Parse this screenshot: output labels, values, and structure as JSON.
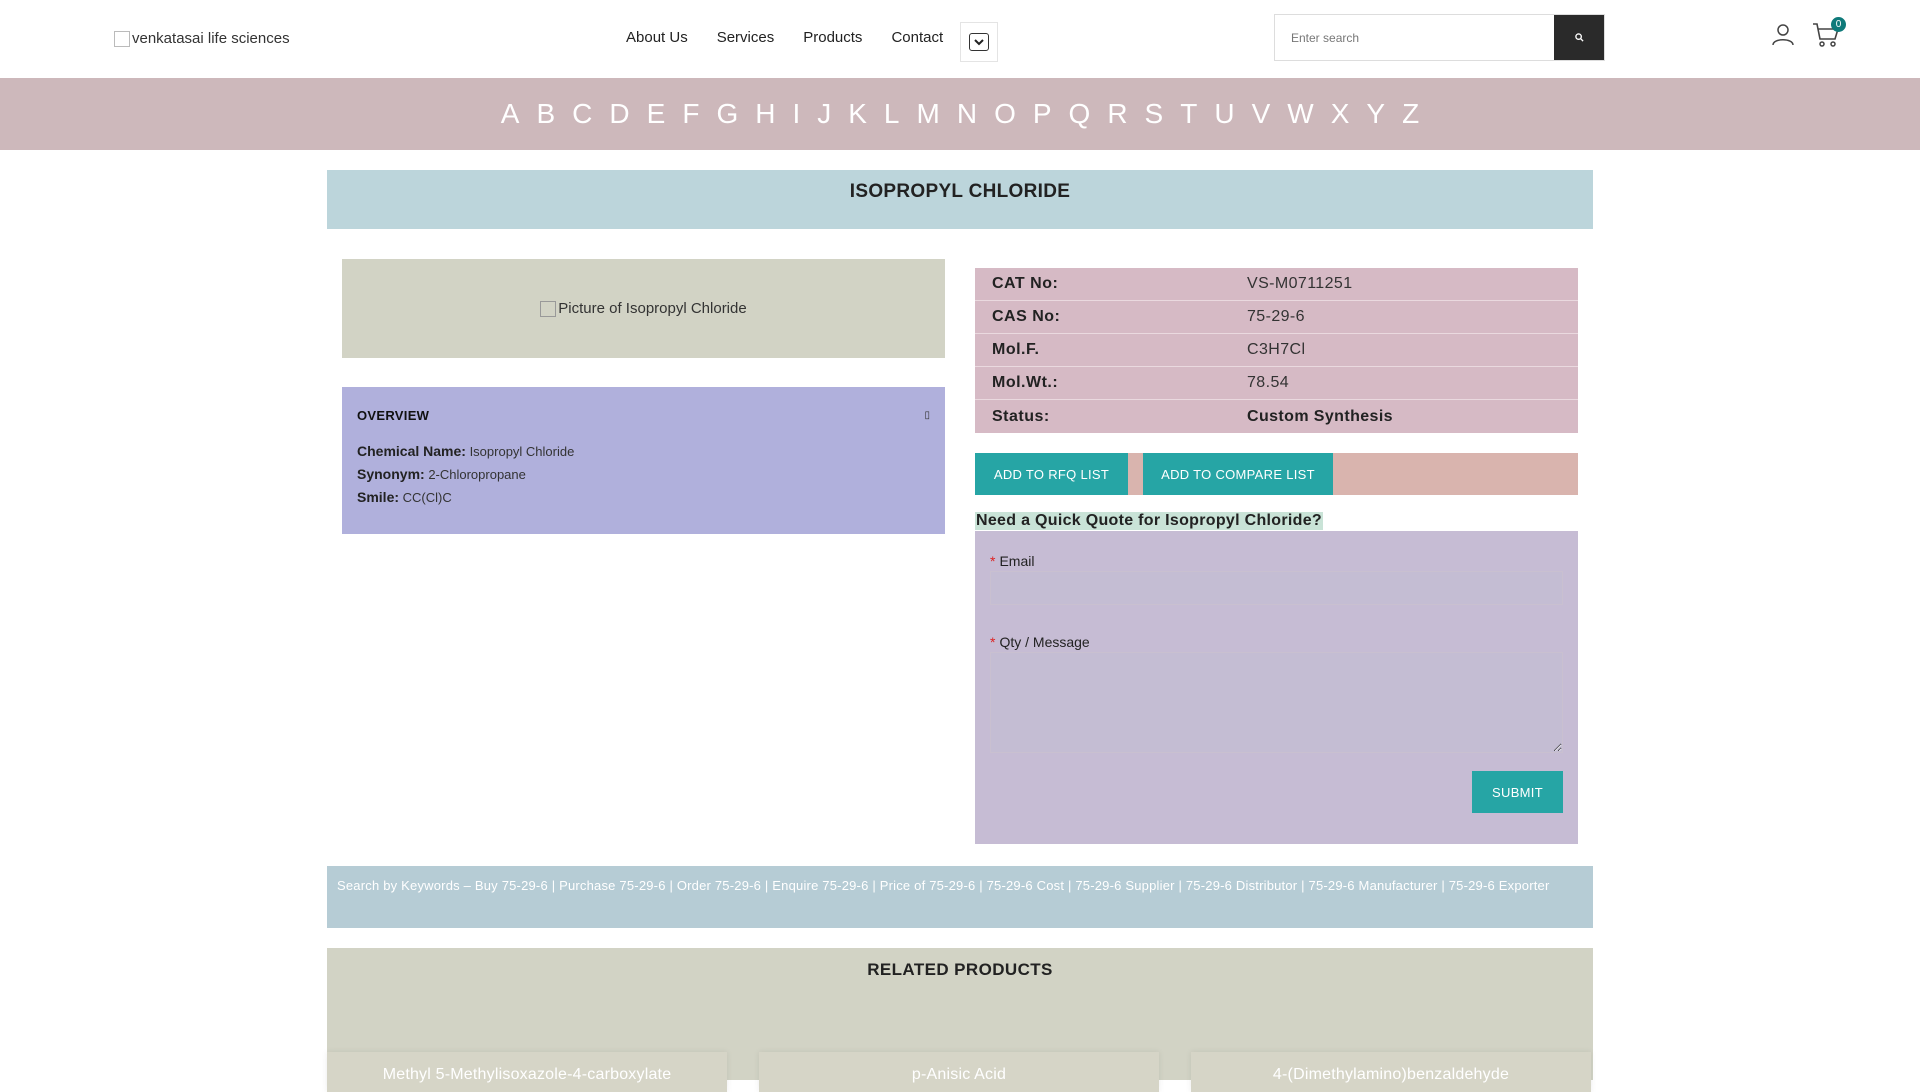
{
  "header": {
    "logo_alt": "venkatasai life sciences",
    "nav": [
      "About Us",
      "Services",
      "Products",
      "Contact"
    ],
    "search_placeholder": "Enter search",
    "cart_count": "0"
  },
  "alphabet": [
    "A",
    "B",
    "C",
    "D",
    "E",
    "F",
    "G",
    "H",
    "I",
    "J",
    "K",
    "L",
    "M",
    "N",
    "O",
    "P",
    "Q",
    "R",
    "S",
    "T",
    "U",
    "V",
    "W",
    "X",
    "Y",
    "Z"
  ],
  "product": {
    "title": "ISOPROPYL CHLORIDE",
    "picture_alt": "Picture of Isopropyl Chloride"
  },
  "overview": {
    "heading": "OVERVIEW",
    "chemical_name_label": "Chemical Name:",
    "chemical_name": "Isopropyl Chloride",
    "synonym_label": "Synonym:",
    "synonym": "2-Chloropropane",
    "smile_label": "Smile:",
    "smile": "CC(Cl)C"
  },
  "spec": {
    "cat_label": "CAT No:",
    "cat": "VS-M0711251",
    "cas_label": "CAS No:",
    "cas": "75-29-6",
    "molf_label": "Mol.F.",
    "molf": "C3H7Cl",
    "molwt_label": "Mol.Wt.:",
    "molwt": "78.54",
    "status_label": "Status:",
    "status": "Custom Synthesis"
  },
  "actions": {
    "rfq": "ADD TO RFQ LIST",
    "compare": "ADD TO COMPARE LIST"
  },
  "quote": {
    "title": "Need a Quick Quote for Isopropyl Chloride?",
    "required_mark": "*",
    "email_label": "Email",
    "message_label": "Qty / Message",
    "submit": "SUBMIT"
  },
  "keywords": "Search by Keywords – Buy 75-29-6 | Purchase 75-29-6 | Order 75-29-6 | Enquire 75-29-6 | Price of 75-29-6 | 75-29-6 Cost | 75-29-6 Supplier | 75-29-6 Distributor | 75-29-6 Manufacturer | 75-29-6 Exporter",
  "related": {
    "heading": "RELATED PRODUCTS",
    "items": [
      "Methyl 5-Methylisoxazole-4-carboxylate",
      "p-Anisic Acid",
      "4-(Dimethylamino)benzaldehyde"
    ]
  },
  "colors": {
    "alphabet_bar": "#cdb8bb",
    "title_bg": "#bcd5db",
    "overview_bg": "#b0b0dc",
    "spec_bg": "#d6bac5",
    "accent_button": "#26a5a5",
    "quote_bg": "#c6bcd4"
  },
  "icons": {
    "search": "search-icon",
    "user": "user-icon",
    "cart": "cart-icon",
    "dropdown": "chevron-down-icon",
    "overview_toggle": "collapse-icon"
  }
}
